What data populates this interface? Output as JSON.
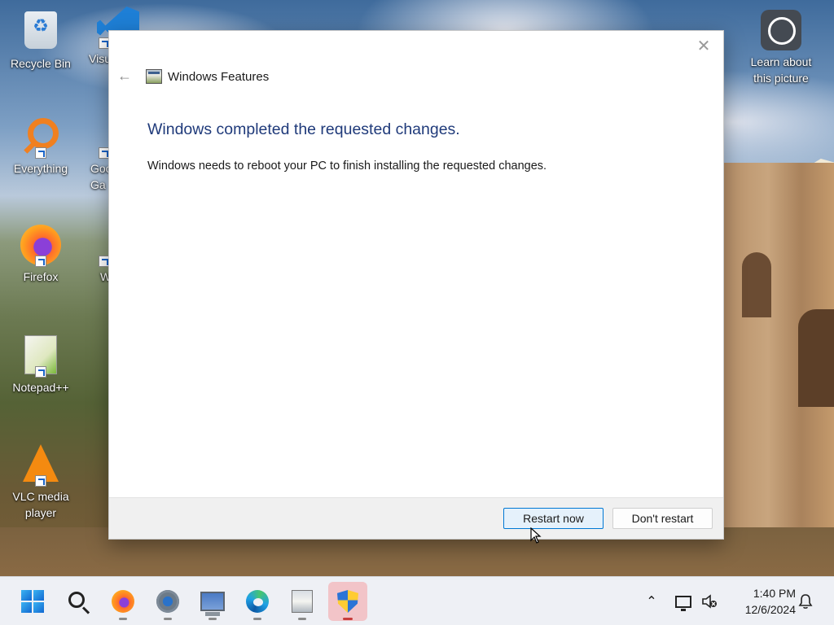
{
  "desktop": {
    "icons": [
      {
        "label": "Recycle Bin"
      },
      {
        "label": "Visu"
      },
      {
        "label": "Everything"
      },
      {
        "label": "Goo"
      },
      {
        "label": "Ga"
      },
      {
        "label": "Firefox"
      },
      {
        "label": "W"
      },
      {
        "label": "Notepad++"
      },
      {
        "label": "VLC media"
      },
      {
        "label": "player"
      },
      {
        "label": "Learn about"
      },
      {
        "label": "this picture"
      }
    ]
  },
  "dialog": {
    "window_title": "Windows Features",
    "close_glyph": "✕",
    "back_glyph": "←",
    "heading": "Windows completed the requested changes.",
    "message": "Windows needs to reboot your PC to finish installing the requested changes.",
    "primary_button": "Restart now",
    "secondary_button": "Don't restart"
  },
  "taskbar": {
    "items": [
      {
        "icon": "start-icon"
      },
      {
        "icon": "search-icon"
      },
      {
        "icon": "firefox-icon"
      },
      {
        "icon": "settings-icon"
      },
      {
        "icon": "computer-icon"
      },
      {
        "icon": "edge-icon"
      },
      {
        "icon": "windows-features-icon"
      },
      {
        "icon": "security-shield-icon",
        "active": true
      }
    ],
    "tray": {
      "chevron": "⌃",
      "time": "1:40 PM",
      "date": "12/6/2024"
    }
  },
  "colors": {
    "heading_blue": "#1f3a7a",
    "primary_border": "#0078d4",
    "active_indicator": "#c83c3c"
  }
}
